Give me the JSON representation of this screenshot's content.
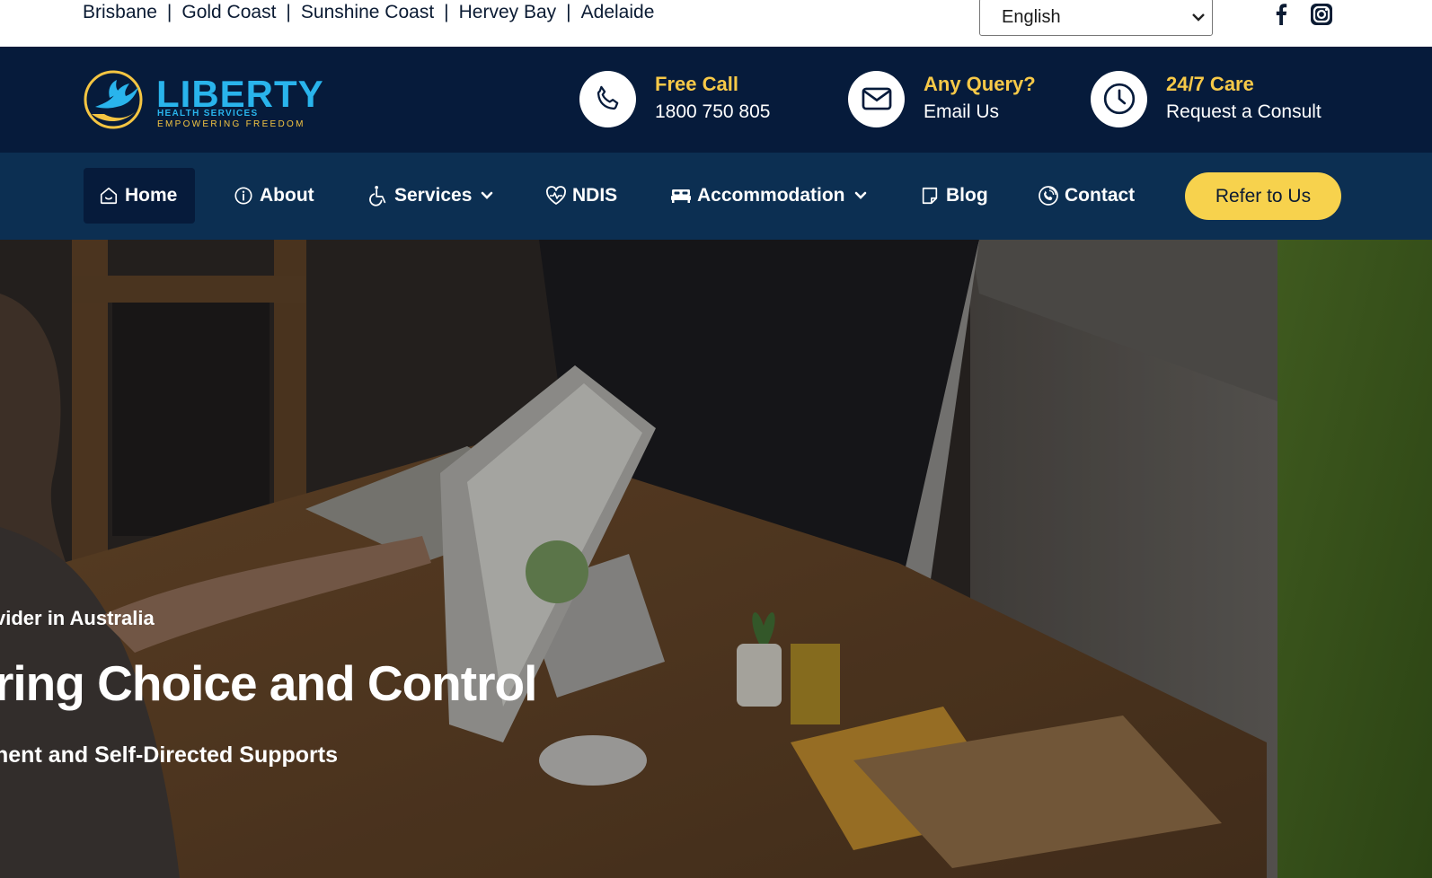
{
  "topbar": {
    "locations": [
      "Brisbane",
      "Gold Coast",
      "Sunshine Coast",
      "Hervey Bay",
      "Adelaide"
    ],
    "separator": "|",
    "language": "English",
    "social_icons": [
      "facebook-icon",
      "instagram-icon"
    ]
  },
  "brand": {
    "name": "LIBERTY",
    "tagline1": "HEALTH SERVICES",
    "tagline2": "EMPOWERING FREEDOM"
  },
  "contacts": [
    {
      "icon": "phone-icon",
      "title": "Free Call",
      "value": "1800 750 805"
    },
    {
      "icon": "mail-icon",
      "title": "Any Query?",
      "value": "Email Us"
    },
    {
      "icon": "clock-icon",
      "title": "24/7 Care",
      "value": "Request a Consult"
    }
  ],
  "nav": {
    "items": [
      {
        "label": "Home",
        "icon": "home-icon",
        "active": true
      },
      {
        "label": "About",
        "icon": "info-icon"
      },
      {
        "label": "Services",
        "icon": "wheelchair-icon",
        "dropdown": true
      },
      {
        "label": "NDIS",
        "icon": "heartbeat-icon"
      },
      {
        "label": "Accommodation",
        "icon": "bed-icon",
        "dropdown": true
      },
      {
        "label": "Blog",
        "icon": "note-icon"
      },
      {
        "label": "Contact",
        "icon": "phone-call-icon"
      }
    ],
    "cta": "Refer to Us"
  },
  "hero": {
    "tagline": "vider in Australia",
    "title": "ring Choice and Control",
    "subtitle": "nent and Self-Directed Supports"
  },
  "colors": {
    "header_bg": "#061b3b",
    "nav_bg": "#0c2f52",
    "accent_yellow": "#f7d24d",
    "brand_blue": "#29b4ec"
  }
}
